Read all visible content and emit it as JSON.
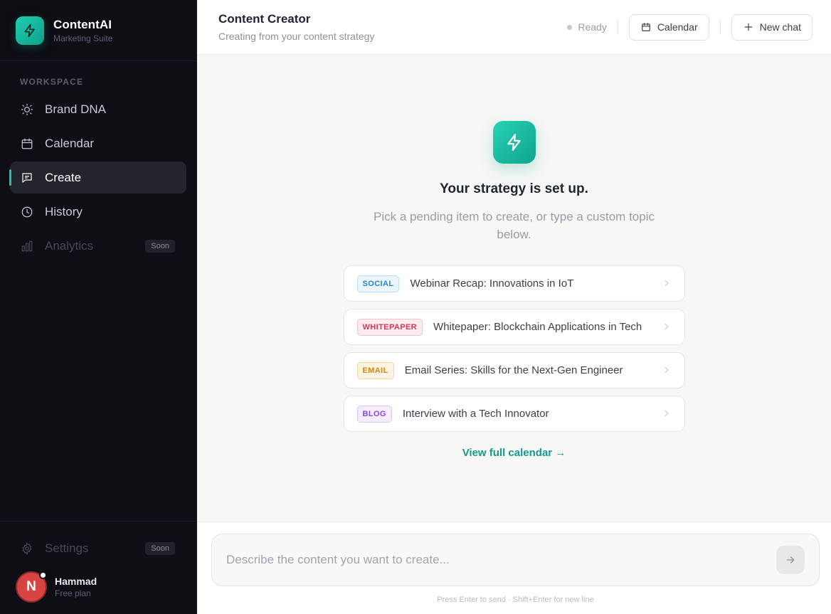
{
  "brand": {
    "name": "ContentAI",
    "subtitle": "Marketing Suite",
    "logo_icon": "bolt-icon"
  },
  "sidebar": {
    "section_label": "WORKSPACE",
    "items": [
      {
        "label": "Brand DNA",
        "icon": "lightbulb-icon",
        "state": "normal"
      },
      {
        "label": "Calendar",
        "icon": "calendar-icon",
        "state": "normal"
      },
      {
        "label": "Create",
        "icon": "chat-icon",
        "state": "active"
      },
      {
        "label": "History",
        "icon": "clock-icon",
        "state": "normal"
      },
      {
        "label": "Analytics",
        "icon": "bar-chart-icon",
        "state": "disabled",
        "badge": "Soon"
      }
    ],
    "settings": {
      "label": "Settings",
      "icon": "gear-icon",
      "badge": "Soon"
    },
    "user": {
      "initial": "N",
      "name": "Hammad",
      "plan": "Free plan"
    }
  },
  "header": {
    "title": "Content Creator",
    "subtitle": "Creating from your content strategy",
    "status": "Ready",
    "calendar_button": "Calendar",
    "new_chat_button": "New chat"
  },
  "hero": {
    "title": "Your strategy is set up.",
    "subtitle": "Pick a pending item to create, or type a custom topic below."
  },
  "pending_items": [
    {
      "tag": "SOCIAL",
      "title": "Webinar Recap: Innovations in IoT"
    },
    {
      "tag": "WHITEPAPER",
      "title": "Whitepaper: Blockchain Applications in Tech"
    },
    {
      "tag": "EMAIL",
      "title": "Email Series: Skills for the Next-Gen Engineer"
    },
    {
      "tag": "BLOG",
      "title": "Interview with a Tech Innovator"
    }
  ],
  "view_calendar_link": "View full calendar →",
  "composer": {
    "placeholder": "Describe the content you want to create...",
    "hint": "Press Enter to send · Shift+Enter for new line"
  },
  "colors": {
    "accent": "#14b8a0",
    "sidebar_bg": "#0e0e14",
    "avatar": "#d84343"
  }
}
